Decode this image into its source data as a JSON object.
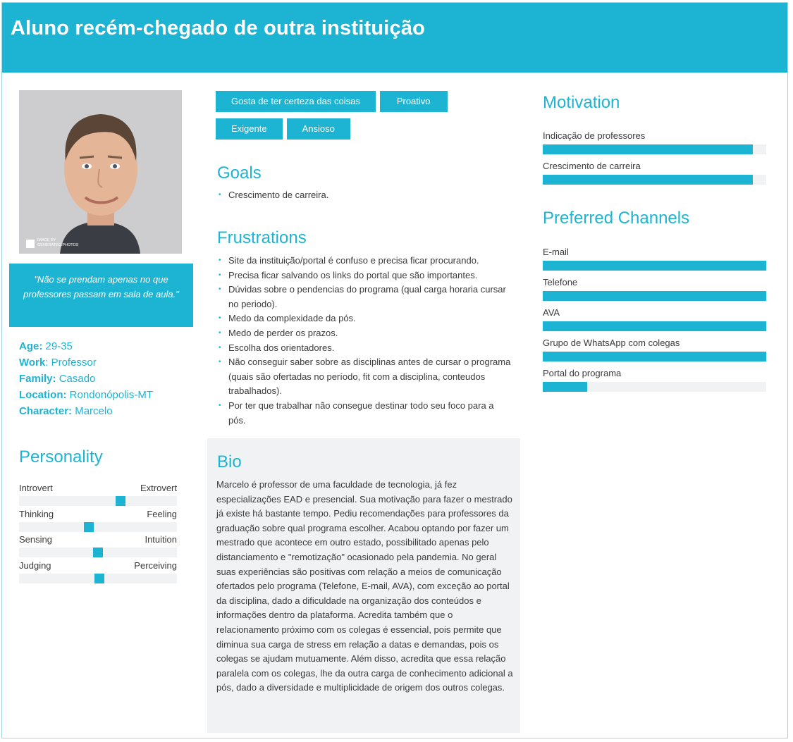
{
  "header": {
    "title": "Aluno recém-chegado de outra instituição"
  },
  "photo": {
    "credit": "IMAGE BY\nGENERATED.PHOTOS",
    "credit_icon": "play-arrow-icon"
  },
  "quote": "\"Não se prendam apenas no que professores passam em sala de aula.\"",
  "facts": [
    {
      "key": "Age:",
      "value": "29-35"
    },
    {
      "key": "Work",
      "value": ": Professor"
    },
    {
      "key": "Family:",
      "value": "Casado"
    },
    {
      "key": "Location:",
      "value": "Rondonópolis-MT"
    },
    {
      "key": "Character:",
      "value": "Marcelo"
    }
  ],
  "personality": {
    "title": "Personality",
    "traits": [
      {
        "left": "Introvert",
        "right": "Extrovert",
        "level": 0.65
      },
      {
        "left": "Thinking",
        "right": "Feeling",
        "level": 0.44
      },
      {
        "left": "Sensing",
        "right": "Intuition",
        "level": 0.5
      },
      {
        "left": "Judging",
        "right": "Perceiving",
        "level": 0.51
      }
    ]
  },
  "tags": [
    "Gosta de ter certeza das coisas",
    "Proativo",
    "Exigente",
    "Ansioso"
  ],
  "goals": {
    "title": "Goals",
    "items": [
      "Crescimento de carreira."
    ]
  },
  "frustrations": {
    "title": "Frustrations",
    "items": [
      "Site da instituição/portal é confuso e precisa ficar procurando.",
      "Precisa ficar salvando os links do portal que são importantes.",
      "Dúvidas sobre o pendencias do programa (qual carga horaria cursar no periodo).",
      "Medo da complexidade da pós.",
      "Medo de perder os prazos.",
      "Escolha dos orientadores.",
      "Não conseguir saber sobre as disciplinas antes de cursar o programa (quais são ofertadas no período, fit com a disciplina, conteudos trabalhados).",
      "Por ter que trabalhar não consegue destinar todo seu foco para a pós."
    ]
  },
  "bio": {
    "title": "Bio",
    "text": "Marcelo é professor de uma faculdade de tecnologia, já fez especializações EAD e presencial. Sua motivação para fazer o mestrado já existe há bastante tempo. Pediu recomendações para professores da graduação sobre qual programa escolher. Acabou optando por fazer um mestrado que acontece em outro estado, possibilitado apenas pelo distanciamento e \"remotização\" ocasionado pela pandemia. No geral suas experiências são positivas com relação a meios de comunicação ofertados pelo programa (Telefone, E-mail, AVA), com exceção ao portal da disciplina, dado a dificuldade na organização dos conteúdos e informações dentro da plataforma. Acredita também que o relacionamento próximo com os colegas é essencial, pois permite que diminua sua carga de stress em relação a datas e demandas, pois os colegas se ajudam mutuamente. Além disso, acredita que essa relação paralela com os colegas, lhe da outra carga de conhecimento adicional a pós, dado a diversidade e multiplicidade de origem dos outros colegas."
  },
  "motivation": {
    "title": "Motivation",
    "items": [
      {
        "label": "Indicação de professores",
        "level": 0.94
      },
      {
        "label": "Crescimento de carreira",
        "level": 0.94
      }
    ]
  },
  "channels": {
    "title": "Preferred Channels",
    "items": [
      {
        "label": "E-mail",
        "level": 1.0
      },
      {
        "label": "Telefone",
        "level": 1.0
      },
      {
        "label": "AVA",
        "level": 1.0
      },
      {
        "label": "Grupo de WhatsApp com colegas",
        "level": 1.0
      },
      {
        "label": "Portal do programa",
        "level": 0.2
      }
    ]
  },
  "colors": {
    "accent": "#1cb4d2",
    "track": "#f1f2f4",
    "text": "#3a3a3a"
  }
}
